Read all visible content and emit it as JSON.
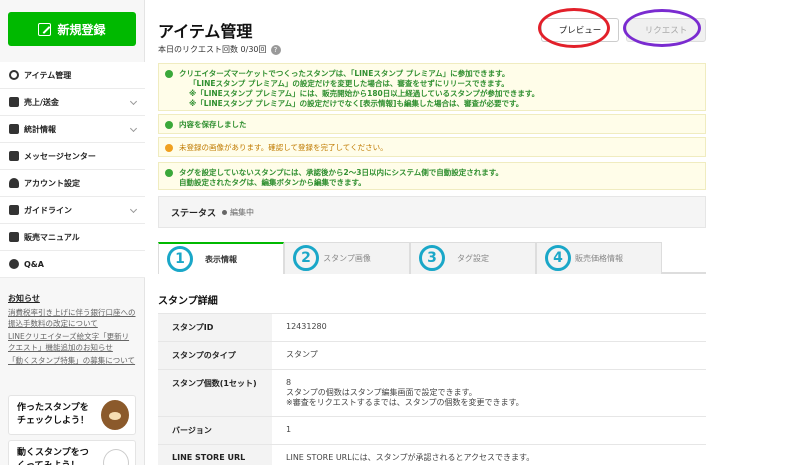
{
  "sidebar": {
    "new_button": "新規登録",
    "items": [
      {
        "label": "アイテム管理",
        "icon": "gear-icon",
        "chevron": false
      },
      {
        "label": "売上/送金",
        "icon": "yen-icon",
        "chevron": true
      },
      {
        "label": "統計情報",
        "icon": "chart-icon",
        "chevron": true
      },
      {
        "label": "メッセージセンター",
        "icon": "mail-icon",
        "chevron": false
      },
      {
        "label": "アカウント設定",
        "icon": "person-icon",
        "chevron": false
      },
      {
        "label": "ガイドライン",
        "icon": "folder-icon",
        "chevron": true
      },
      {
        "label": "販売マニュアル",
        "icon": "book-icon",
        "chevron": false
      },
      {
        "label": "Q&A",
        "icon": "question-icon",
        "chevron": false
      }
    ],
    "notice_title": "お知らせ",
    "notices": [
      "消費税率引き上げに伴う銀行口座への振込手数料の改定について",
      "LINEクリエイターズ絵文字「更新リクエスト」機能追加のお知らせ",
      "「動くスタンプ特集」の募集について"
    ],
    "banners": [
      {
        "text": "作ったスタンプをチェックしよう！"
      },
      {
        "text": "動くスタンプをつくってみよう！"
      }
    ]
  },
  "header": {
    "title": "アイテム管理",
    "request_count": "本日のリクエスト回数 0/30回",
    "preview_button": "プレビュー",
    "request_button": "リクエスト"
  },
  "alerts": {
    "premium": [
      "クリエイターズマーケットでつくったスタンプは、「LINEスタンプ プレミアム」に参加できます。",
      "「LINEスタンプ プレミアム」の設定だけを変更した場合は、審査をせずにリリースできます。",
      "※「LINEスタンプ プレミアム」には、販売開始から180日以上経過しているスタンプが参加できます。",
      "※「LINEスタンプ プレミアム」の設定だけでなく[表示情報]も編集した場合は、審査が必要です。"
    ],
    "saved": "内容を保存しました",
    "unregistered": "未登録の画像があります。確認して登録を完了してください。",
    "tags": [
      "タグを設定していないスタンプには、承認後から2～3日以内にシステム側で自動設定されます。",
      "自動設定されたタグは、編集ボタンから編集できます。"
    ]
  },
  "status": {
    "label": "ステータス",
    "value": "編集中"
  },
  "tabs": [
    {
      "num": "1",
      "label": "表示情報",
      "active": true
    },
    {
      "num": "2",
      "label": "スタンプ画像",
      "active": false
    },
    {
      "num": "3",
      "label": "タグ設定",
      "active": false
    },
    {
      "num": "4",
      "label": "販売価格情報",
      "active": false
    }
  ],
  "details": {
    "title": "スタンプ詳細",
    "rows": [
      {
        "key": "スタンプID",
        "value": "12431280"
      },
      {
        "key": "スタンプのタイプ",
        "value": "スタンプ"
      },
      {
        "key": "スタンプ個数(1セット)",
        "value": "8",
        "note1": "スタンプの個数はスタンプ編集画面で設定できます。",
        "note2": "※審査をリクエストするまでは、スタンプの個数を変更できます。"
      },
      {
        "key": "バージョン",
        "value": "1"
      },
      {
        "key": "LINE STORE URL",
        "value": "LINE STORE URLには、スタンプが承認されるとアクセスできます。"
      }
    ]
  },
  "colors": {
    "accent": "#00b900",
    "annotation_red": "#e2202a",
    "annotation_purple": "#7a2bd0",
    "annotation_blue": "#1aa7c8"
  }
}
